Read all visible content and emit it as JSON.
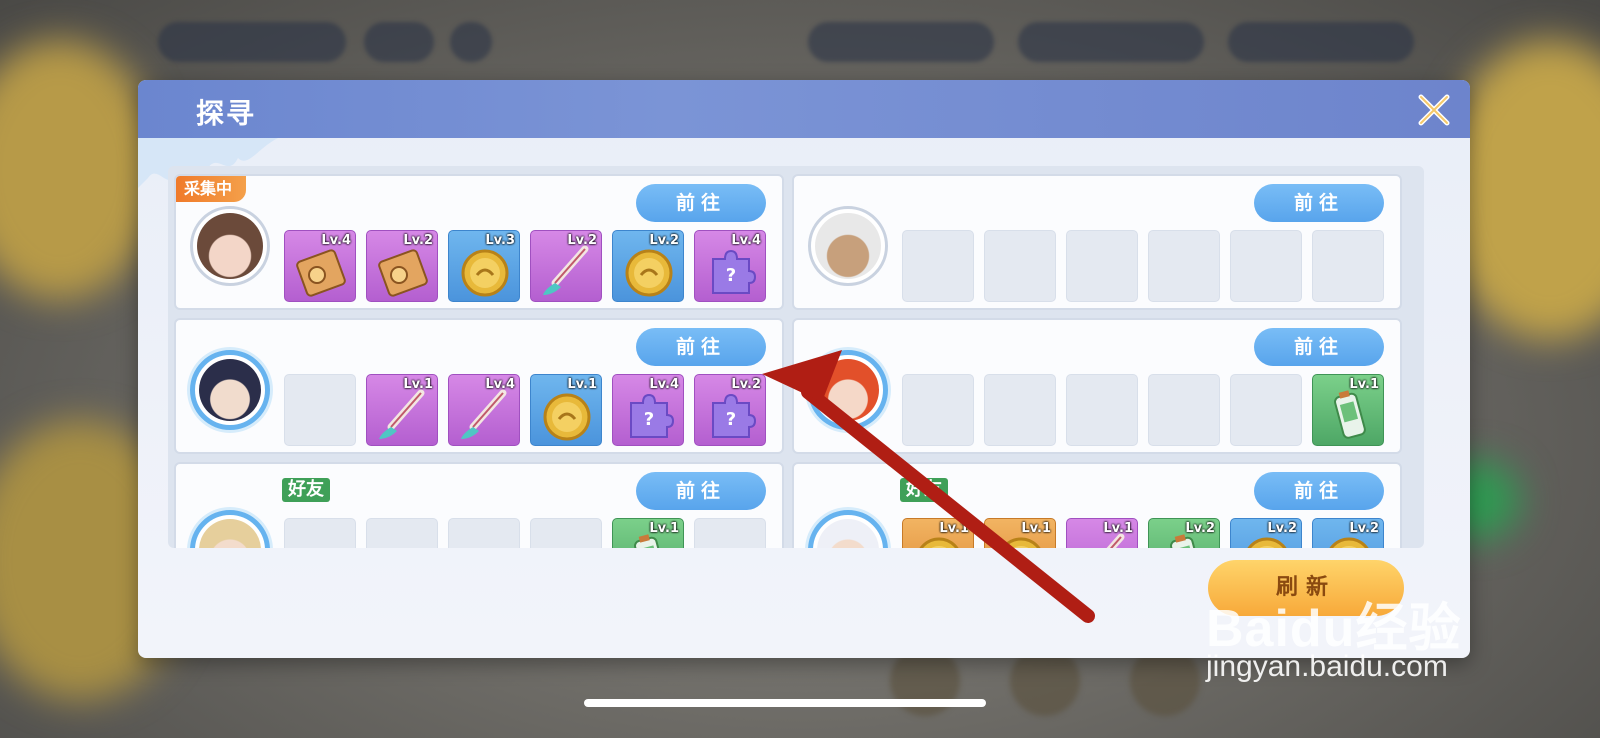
{
  "panel": {
    "title": "探寻",
    "close_icon": "close-x-icon",
    "refresh_label": "刷新",
    "go_label": "前往",
    "collecting_label": "采集中",
    "friend_label": "好友"
  },
  "cards": [
    {
      "character": "girl-brown-hair",
      "status": "采集中",
      "slots": [
        {
          "item": "tag-icon",
          "color": "purple",
          "level": "Lv.4"
        },
        {
          "item": "tag-icon",
          "color": "purple",
          "level": "Lv.2"
        },
        {
          "item": "coin-icon",
          "color": "blue",
          "level": "Lv.3"
        },
        {
          "item": "brush-icon",
          "color": "purple",
          "level": "Lv.2"
        },
        {
          "item": "coin-icon",
          "color": "blue",
          "level": "Lv.2"
        },
        {
          "item": "puzzle-icon",
          "color": "purple",
          "level": "Lv.4"
        }
      ]
    },
    {
      "character": "old-man-sunglasses",
      "slots": [
        {
          "item": "empty",
          "color": "empty",
          "level": ""
        },
        {
          "item": "empty",
          "color": "empty",
          "level": ""
        },
        {
          "item": "empty",
          "color": "empty",
          "level": ""
        },
        {
          "item": "empty",
          "color": "empty",
          "level": ""
        },
        {
          "item": "empty",
          "color": "empty",
          "level": ""
        },
        {
          "item": "empty",
          "color": "empty",
          "level": ""
        }
      ]
    },
    {
      "character": "boy-dark-hair",
      "slots": [
        {
          "item": "empty",
          "color": "empty",
          "level": ""
        },
        {
          "item": "brush-icon",
          "color": "purple",
          "level": "Lv.1"
        },
        {
          "item": "brush-icon",
          "color": "purple",
          "level": "Lv.4"
        },
        {
          "item": "coin-icon",
          "color": "blue",
          "level": "Lv.1"
        },
        {
          "item": "puzzle-icon",
          "color": "purple",
          "level": "Lv.4"
        },
        {
          "item": "puzzle-icon",
          "color": "purple",
          "level": "Lv.2"
        }
      ]
    },
    {
      "character": "girl-red-hair",
      "slots": [
        {
          "item": "empty",
          "color": "empty",
          "level": ""
        },
        {
          "item": "empty",
          "color": "empty",
          "level": ""
        },
        {
          "item": "empty",
          "color": "empty",
          "level": ""
        },
        {
          "item": "empty",
          "color": "empty",
          "level": ""
        },
        {
          "item": "empty",
          "color": "empty",
          "level": ""
        },
        {
          "item": "battery-icon",
          "color": "green",
          "level": "Lv.1"
        }
      ]
    },
    {
      "character": "girl-blonde-hair",
      "friend": true,
      "slots": [
        {
          "item": "empty",
          "color": "empty",
          "level": ""
        },
        {
          "item": "empty",
          "color": "empty",
          "level": ""
        },
        {
          "item": "empty",
          "color": "empty",
          "level": ""
        },
        {
          "item": "empty",
          "color": "empty",
          "level": ""
        },
        {
          "item": "battery-icon",
          "color": "green",
          "level": "Lv.1"
        },
        {
          "item": "empty",
          "color": "empty",
          "level": ""
        }
      ]
    },
    {
      "character": "girl-white-hair",
      "friend": true,
      "slots": [
        {
          "item": "coin-icon",
          "color": "orange",
          "level": "Lv.1"
        },
        {
          "item": "coin-icon",
          "color": "orange",
          "level": "Lv.1"
        },
        {
          "item": "brush-icon",
          "color": "purple",
          "level": "Lv.1"
        },
        {
          "item": "battery-icon",
          "color": "green",
          "level": "Lv.2"
        },
        {
          "item": "coin-icon",
          "color": "blue",
          "level": "Lv.2"
        },
        {
          "item": "coin-icon",
          "color": "blue",
          "level": "Lv.2"
        }
      ]
    }
  ],
  "watermark": {
    "logo": "Baidu经验",
    "url": "jingyan.baidu.com"
  },
  "colors": {
    "header": "#6b86cf",
    "go_button": "#58a4ec",
    "refresh_button": "#f7a93a",
    "arrow": "#b01e14"
  }
}
